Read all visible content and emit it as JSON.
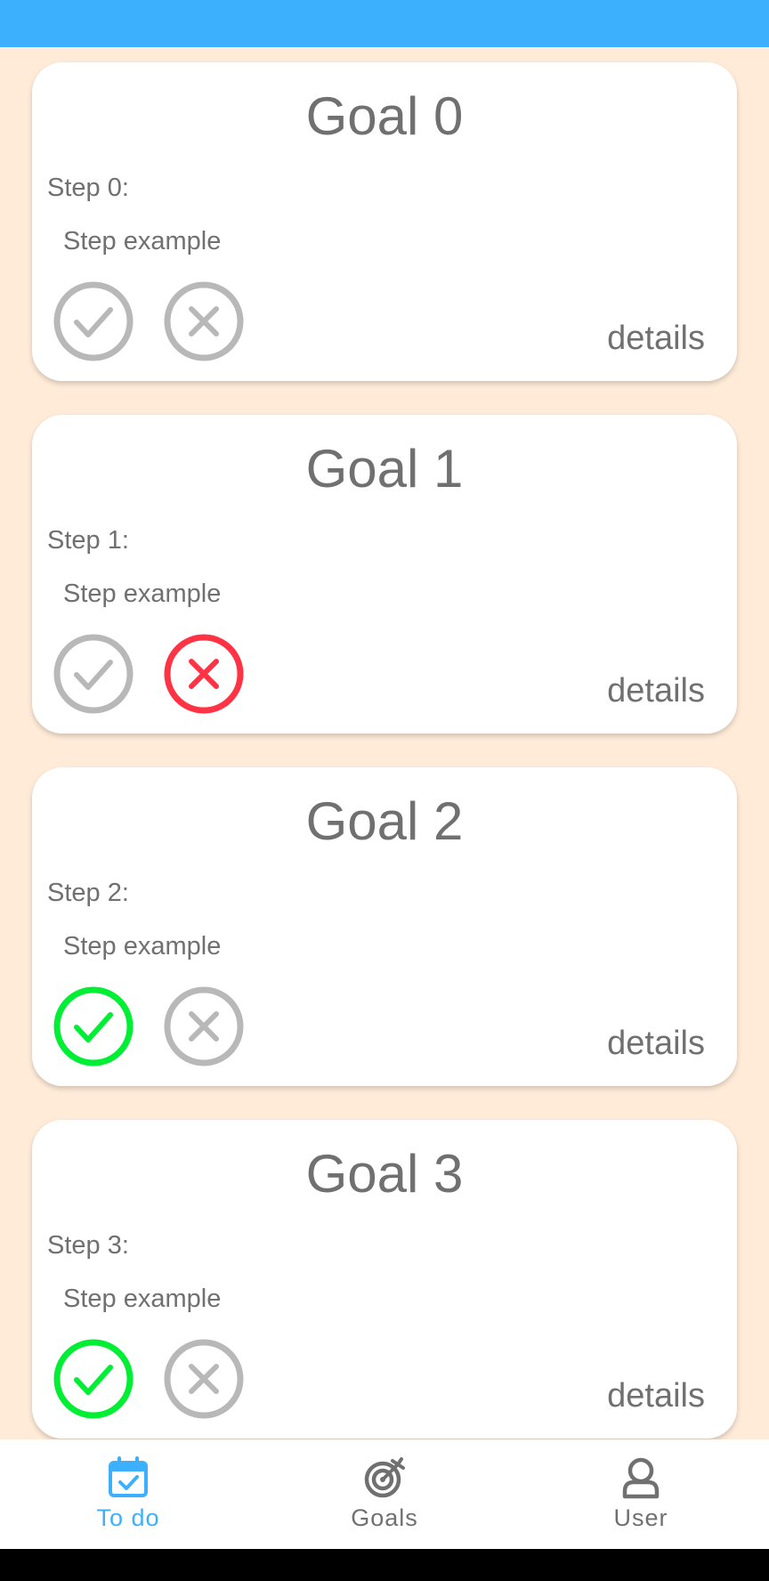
{
  "colors": {
    "status_bar": "#3db0fd",
    "background": "#ffebd8",
    "card": "#ffffff",
    "text": "#707070",
    "inactive_icon": "#b8b8b8",
    "done": "#00ee33",
    "failed": "#ff3344",
    "nav_active": "#3db0fd"
  },
  "goals": [
    {
      "title": "Goal 0",
      "step_label": "Step 0:",
      "step_text": "Step example",
      "done": false,
      "failed": false,
      "details_label": "details"
    },
    {
      "title": "Goal 1",
      "step_label": "Step 1:",
      "step_text": "Step example",
      "done": false,
      "failed": true,
      "details_label": "details"
    },
    {
      "title": "Goal 2",
      "step_label": "Step 2:",
      "step_text": "Step example",
      "done": true,
      "failed": false,
      "details_label": "details"
    },
    {
      "title": "Goal 3",
      "step_label": "Step 3:",
      "step_text": "Step example",
      "done": true,
      "failed": false,
      "details_label": "details"
    }
  ],
  "nav": {
    "items": [
      {
        "label": "To do",
        "icon": "calendar-check-icon",
        "active": true
      },
      {
        "label": "Goals",
        "icon": "target-icon",
        "active": false
      },
      {
        "label": "User",
        "icon": "user-icon",
        "active": false
      }
    ]
  }
}
